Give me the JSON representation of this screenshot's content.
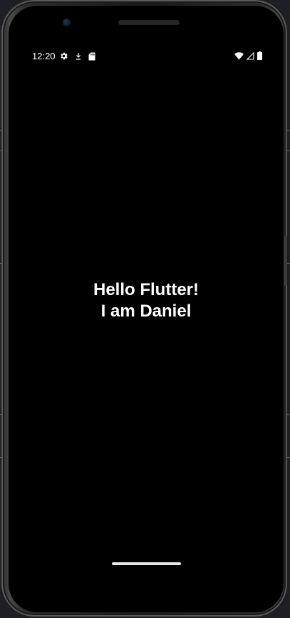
{
  "status_bar": {
    "time": "12:20",
    "left_icons": [
      "settings-gear-icon",
      "download-arrow-icon",
      "sd-card-icon"
    ],
    "right_icons": [
      "wifi-icon",
      "cell-signal-icon",
      "battery-icon"
    ]
  },
  "app": {
    "line1": "Hello Flutter!",
    "line2": "I am Daniel",
    "background_color": "#000000",
    "text_color": "#ffffff"
  }
}
